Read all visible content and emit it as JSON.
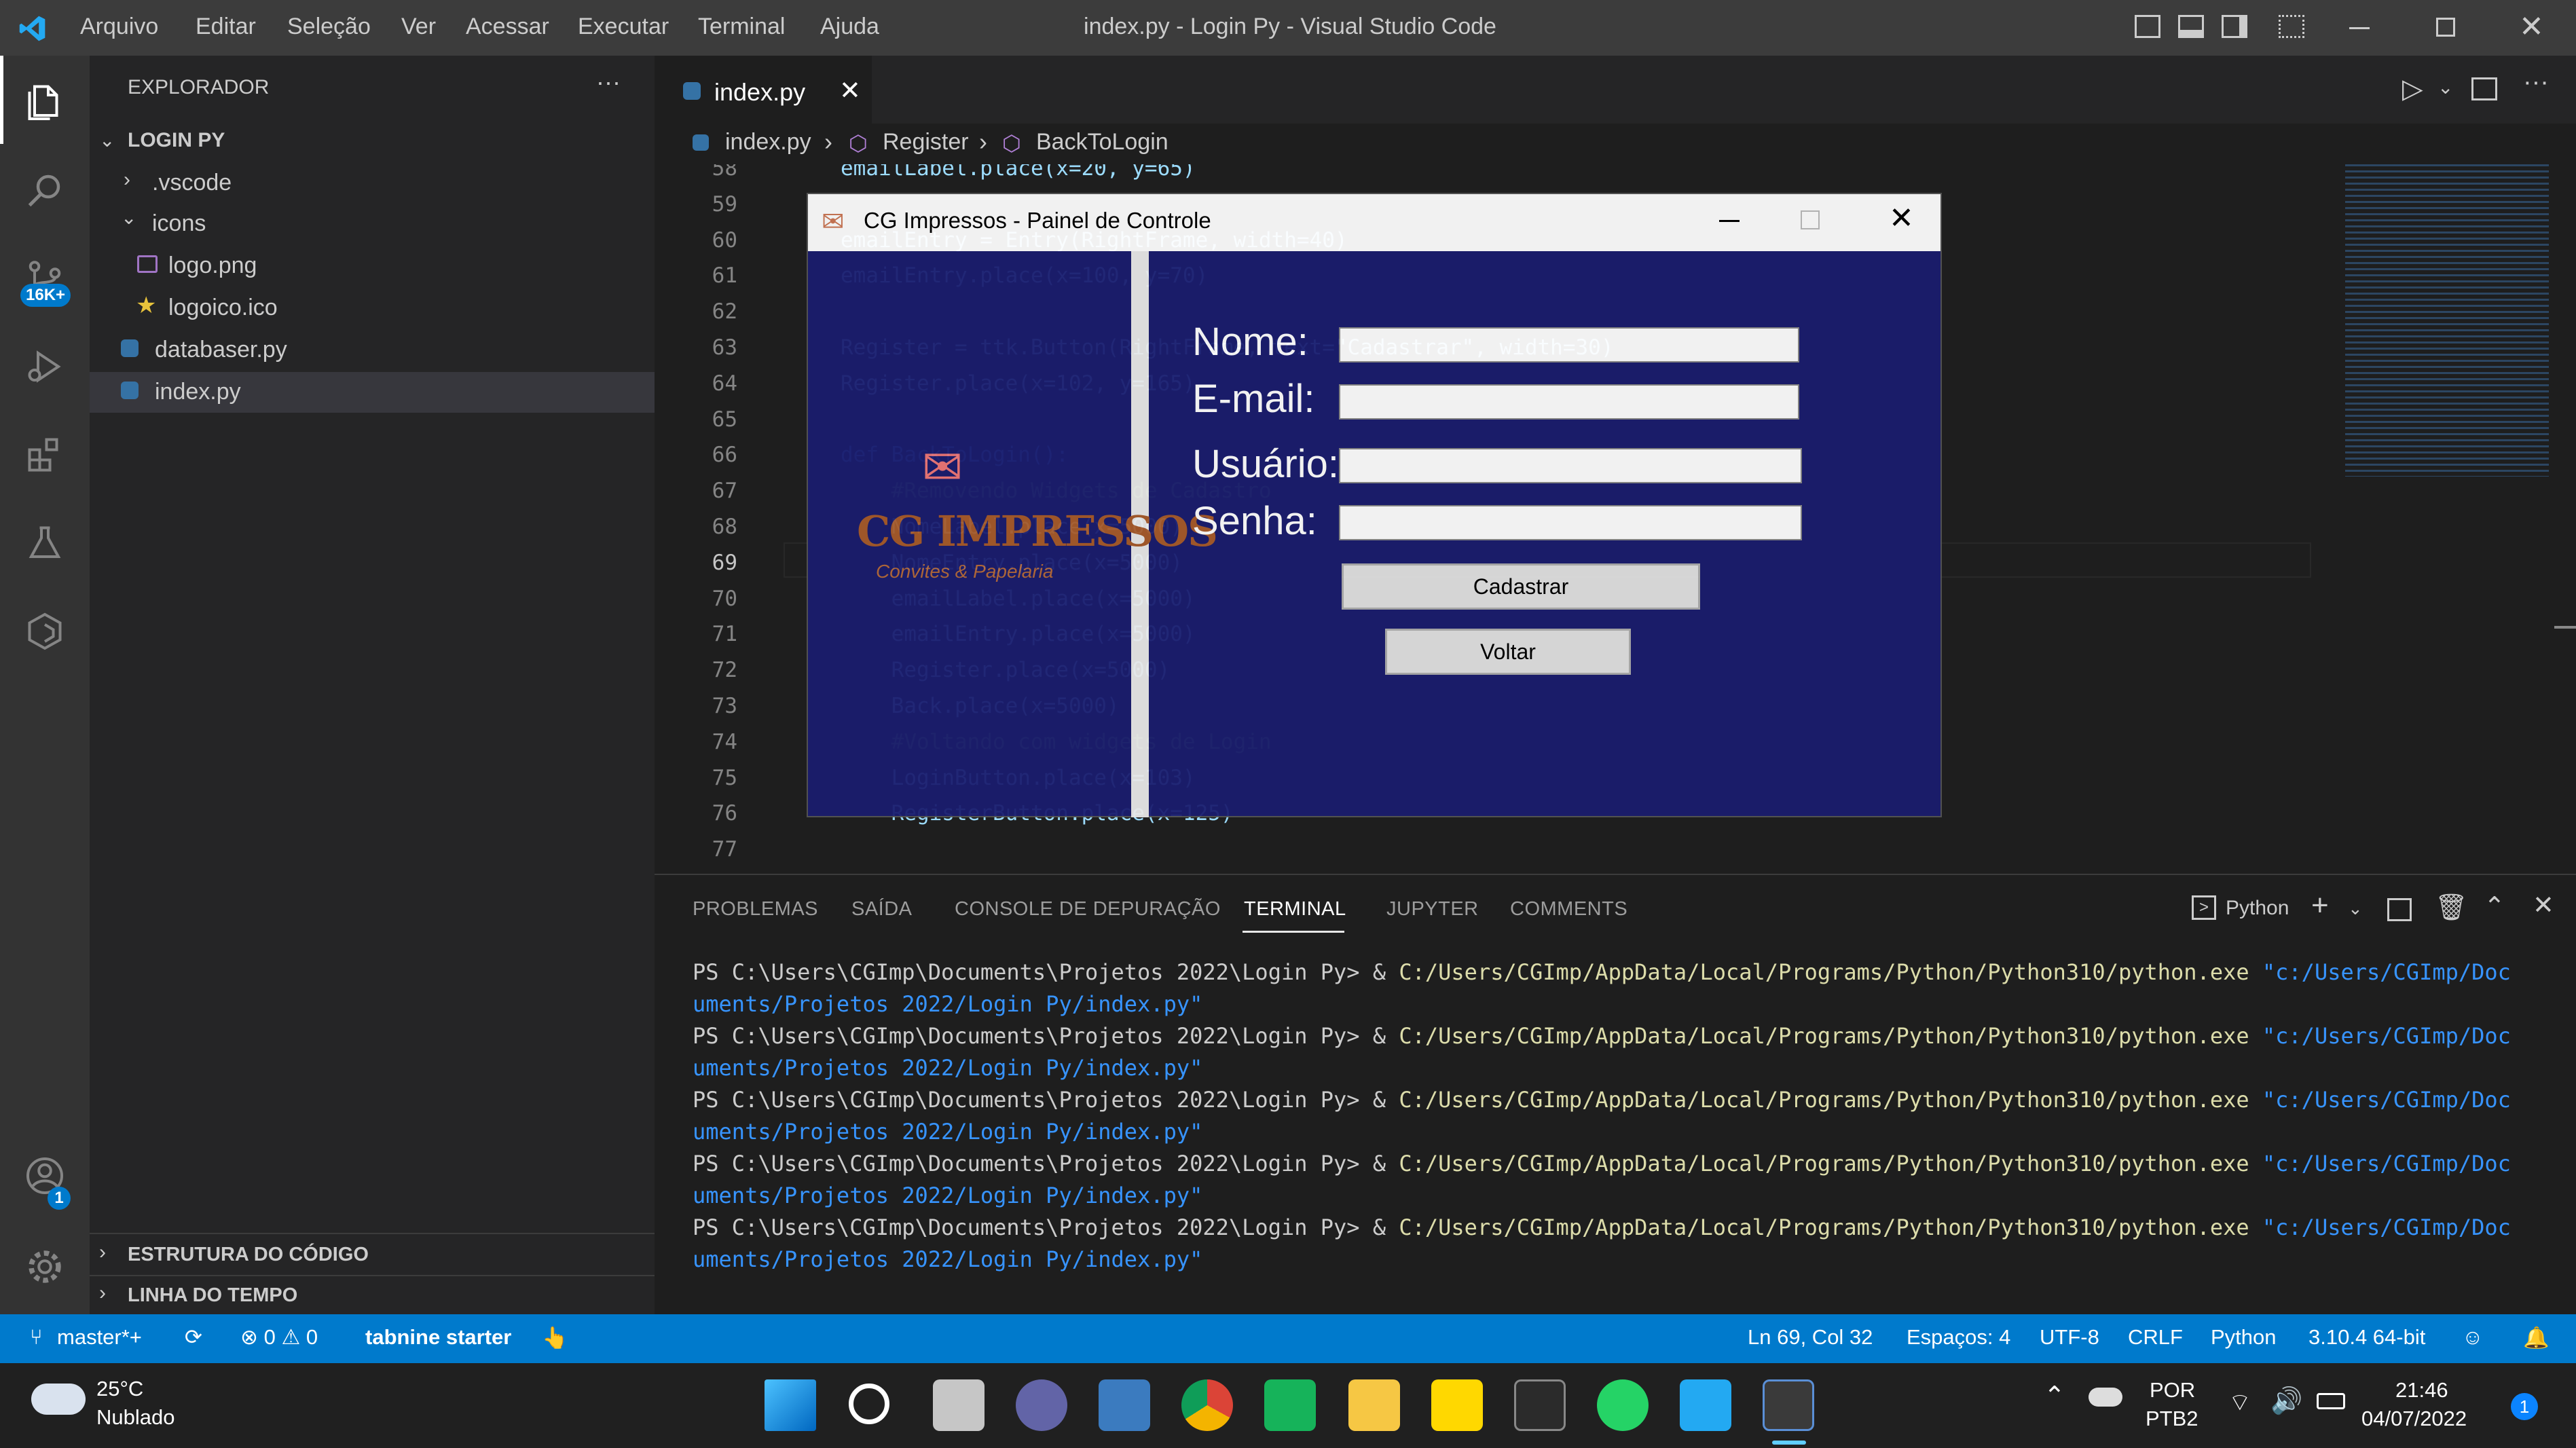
{
  "titlebar": {
    "menu": [
      "Arquivo",
      "Editar",
      "Seleção",
      "Ver",
      "Acessar",
      "Executar",
      "Terminal",
      "Ajuda"
    ],
    "title": "index.py - Login Py - Visual Studio Code"
  },
  "activity": {
    "scm_badge": "16K+",
    "account_badge": "1"
  },
  "sidebar": {
    "header": "EXPLORADOR",
    "project": "LOGIN PY",
    "items": [
      ".vscode",
      "icons",
      "logo.png",
      "logoico.ico",
      "databaser.py",
      "index.py"
    ],
    "outline": "ESTRUTURA DO CÓDIGO",
    "timeline": "LINHA DO TEMPO"
  },
  "editor": {
    "tab": "index.py",
    "breadcrumb": [
      "index.py",
      "Register",
      "BackToLogin"
    ],
    "lines": [
      {
        "n": "58",
        "code": "emailLabel.place(x=20, y=65)"
      },
      {
        "n": "59",
        "code": ""
      },
      {
        "n": "60",
        "code": "emailEntry = Entry(RightFrame, width=40)"
      },
      {
        "n": "61",
        "code": "emailEntry.place(x=100, y=70)"
      },
      {
        "n": "62",
        "code": ""
      },
      {
        "n": "63",
        "code": "Register = ttk.Button(RightFrame, text=\"Cadastrar\", width=30)"
      },
      {
        "n": "64",
        "code": "Register.place(x=102, y=165)"
      },
      {
        "n": "65",
        "code": ""
      },
      {
        "n": "66",
        "code": "def BackToLogin():"
      },
      {
        "n": "67",
        "code": "    #Removendo Widgets de Cadastro"
      },
      {
        "n": "68",
        "code": "    NomeLabel.place(x=5000)"
      },
      {
        "n": "69",
        "code": "    NomeEntry.place(x=5000)"
      },
      {
        "n": "70",
        "code": "    emailLabel.place(x=5000)"
      },
      {
        "n": "71",
        "code": "    emailEntry.place(x=5000)"
      },
      {
        "n": "72",
        "code": "    Register.place(x=5000)"
      },
      {
        "n": "73",
        "code": "    Back.place(x=5000)"
      },
      {
        "n": "74",
        "code": "    #Voltando com widgets de Login"
      },
      {
        "n": "75",
        "code": "    LoginButton.place(x=103)"
      },
      {
        "n": "76",
        "code": "    RegisterButton.place(x=125)"
      },
      {
        "n": "77",
        "code": ""
      }
    ]
  },
  "tkinter": {
    "title": "CG Impressos - Painel de Controle",
    "logo_text": "CG IMPRESSOS",
    "logo_sub": "Convites & Papelaria",
    "labels": {
      "nome": "Nome:",
      "email": "E-mail:",
      "usuario": "Usuário:",
      "senha": "Senha:"
    },
    "buttons": {
      "cadastrar": "Cadastrar",
      "voltar": "Voltar"
    }
  },
  "panel": {
    "tabs": [
      "PROBLEMAS",
      "SAÍDA",
      "CONSOLE DE DEPURAÇÃO",
      "TERMINAL",
      "JUPYTER",
      "COMMENTS"
    ],
    "active_tab": "TERMINAL",
    "shell": "Python",
    "prompt": "PS C:\\Users\\CGImp\\Documents\\Projetos 2022\\Login Py> & ",
    "exe": "C:/Users/CGImp/AppData/Local/Programs/Python/Python310/python.exe",
    "arg1": " \"c:/Users/CGImp/Doc",
    "arg2": "uments/Projetos 2022/Login Py/index.py\""
  },
  "status": {
    "branch": "master*+",
    "problems": "⊗ 0 ⚠ 0",
    "tabnine": "tabnine starter",
    "position": "Ln 69, Col 32",
    "spaces": "Espaços: 4",
    "encoding": "UTF-8",
    "eol": "CRLF",
    "language": "Python",
    "version": "3.10.4 64-bit"
  },
  "taskbar": {
    "temp": "25°C",
    "weather": "Nublado",
    "lang1": "POR",
    "lang2": "PTB2",
    "time": "21:46",
    "date": "04/07/2022",
    "notif": "1"
  },
  "colors": {
    "accent": "#007acc",
    "tk_bg": "#1a1c6e",
    "string": "#ce9178",
    "exe": "#dcdcaa",
    "path": "#3794ff"
  }
}
